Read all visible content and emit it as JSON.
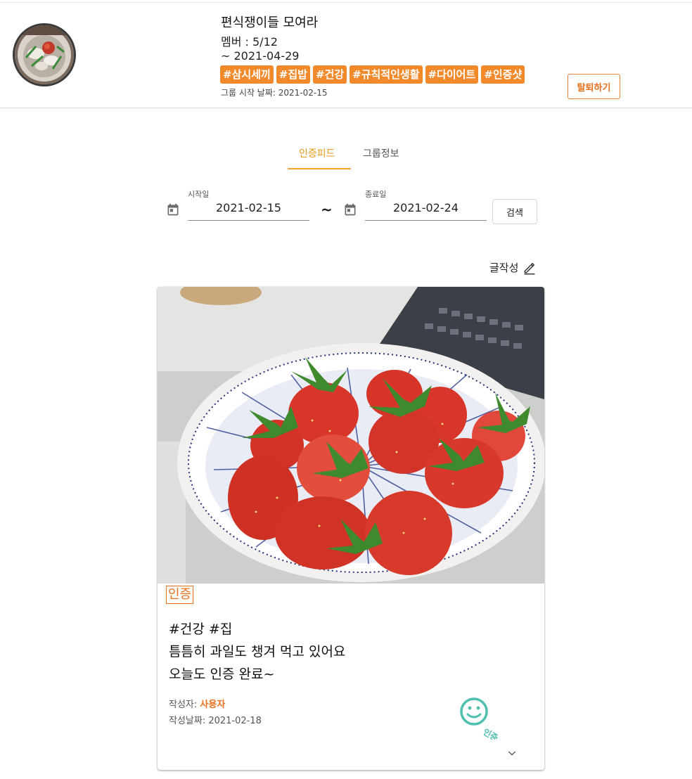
{
  "group": {
    "title": "편식쟁이들 모여라",
    "members": "멤버 : 5/12",
    "end_date": "~ 2021-04-29",
    "tags": [
      "#삼시세끼",
      "#집밥",
      "#건강",
      "#규칙적인생활",
      "#다이어트",
      "#인증샷"
    ],
    "start_date": "그룹 시작 날짜: 2021-02-15",
    "leave_label": "탈퇴하기"
  },
  "tabs": [
    "인증피드",
    "그룹정보"
  ],
  "filter": {
    "start_label": "시작일",
    "start_value": "2021-02-15",
    "separator": "~",
    "end_label": "종료일",
    "end_value": "2021-02-24",
    "search_label": "검색"
  },
  "write_label": "글작성",
  "post": {
    "badge": "인증",
    "lines": [
      "#건강 #집",
      "틈틈히 과일도 챙겨 먹고 있어요",
      "오늘도 인증 완료~"
    ],
    "author_label": "작성자: ",
    "author_name": "사용자",
    "date": "작성날짜: 2021-02-18",
    "stamp_text": "인증"
  },
  "colors": {
    "accent": "#f28a2c",
    "tab_active": "#e89b18",
    "stamp": "#4fbfae"
  },
  "icons": [
    "calendar-icon",
    "pencil-icon",
    "smiley-icon",
    "chevron-down-icon"
  ]
}
